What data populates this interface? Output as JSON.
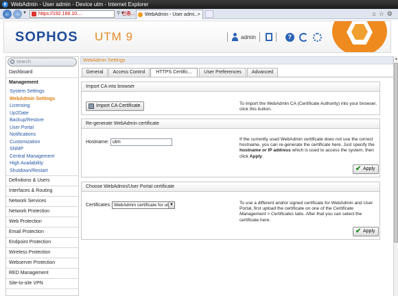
{
  "window": {
    "title": "WebAdmin - User admin - Device utm - Internet Explorer"
  },
  "browser": {
    "address": "https://192.168.10....",
    "cert_error": "인증...",
    "tab_title": "WebAdmin - User admi..."
  },
  "header": {
    "brand": "SOPHOS",
    "product": "UTM 9",
    "user": "admin"
  },
  "sidebar": {
    "search_placeholder": "search",
    "items": [
      "Dashboard"
    ],
    "management_group": "Management",
    "management_items": [
      "System Settings",
      "WebAdmin Settings",
      "Licensing",
      "Up2Date",
      "Backup/Restore",
      "User Portal",
      "Notifications",
      "Customization",
      "SNMP",
      "Central Management",
      "High Availability",
      "Shutdown/Restart"
    ],
    "groups": [
      "Definitions & Users",
      "Interfaces & Routing",
      "Network Services",
      "Network Protection",
      "Web Protection",
      "Email Protection",
      "Endpoint Protection",
      "Wireless Protection",
      "Webserver Protection",
      "RED Management",
      "Site-to-site VPN"
    ]
  },
  "page": {
    "title": "WebAdmin Settings",
    "tabs": [
      "General",
      "Access Control",
      "HTTPS Certific...",
      "User Preferences",
      "Advanced"
    ],
    "active_tab": 2
  },
  "import_ca": {
    "title": "Import CA into browser",
    "button": "Import CA Certificate",
    "desc": "To import the WebAdmin CA (Certificate Authority) into your browser, click this button."
  },
  "regen": {
    "title": "Re-generate WebAdmin certificate",
    "hostname_label": "Hostname:",
    "hostname_value": "utm",
    "desc_1": "If the currently used WebAdmin certificate does not use the correct hostname, you can re-generate the certificate here. Just specify the ",
    "desc_bold_1": "hostname or IP address",
    "desc_2": " which is used to access the system, then click ",
    "desc_bold_2": "Apply",
    "desc_3": ".",
    "apply": "Apply"
  },
  "portal_cert": {
    "title": "Choose WebAdmin/User Portal certificate",
    "cert_label": "Certificates:",
    "cert_value": "WebAdmin certificate for utm",
    "desc_1": "To use a different and/or signed certificate for WebAdmin and User Portal, first upload the certificate on one of the ",
    "desc_italic": "Certificate Management > Certificates",
    "desc_2": " tabs. After that you can select the certificate here.",
    "apply": "Apply"
  },
  "colors": {
    "brand_blue": "#1f4d9b",
    "accent_orange": "#e07d10",
    "link_blue": "#2456a6"
  }
}
